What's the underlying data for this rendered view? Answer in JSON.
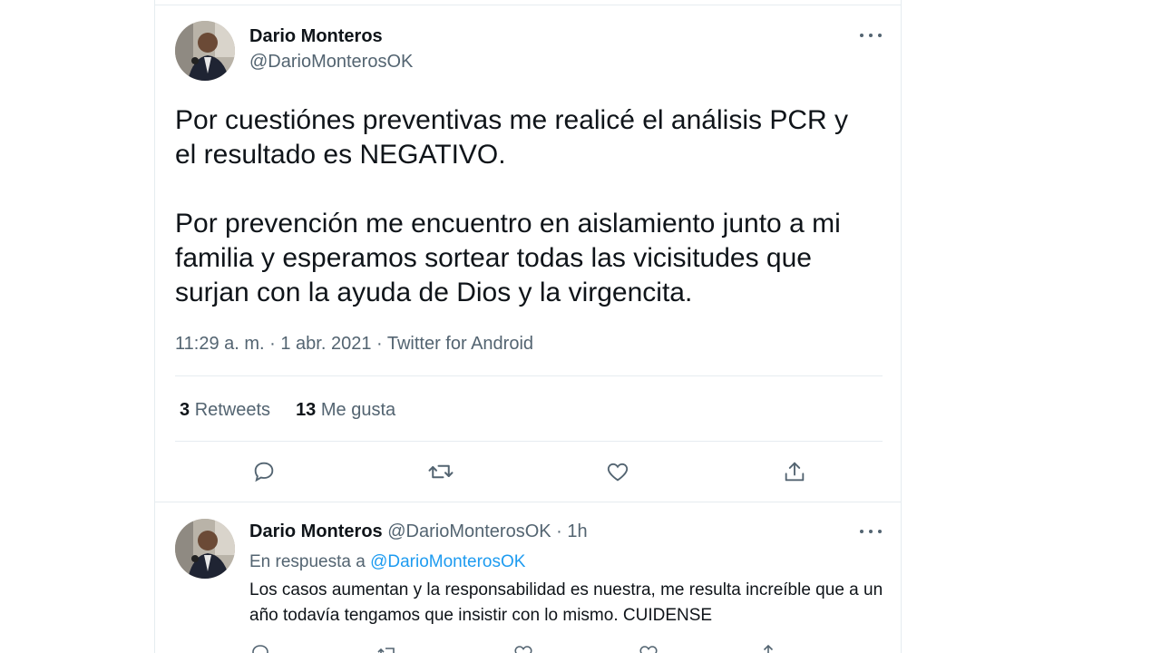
{
  "main_tweet": {
    "author_name": "Dario Monteros",
    "author_handle": "@DarioMonterosOK",
    "text": "Por cuestiónes preventivas me realicé el análisis PCR y\nel resultado es NEGATIVO.\n\nPor prevención me encuentro en aislamiento junto a mi\nfamilia y esperamos sortear todas las vicisitudes que\nsurjan con la ayuda de Dios y la virgencita.",
    "timestamp": "11:29 a. m. · 1 abr. 2021 · Twitter for Android",
    "retweets_count": "3",
    "retweets_label": "Retweets",
    "likes_count": "13",
    "likes_label": "Me gusta",
    "icons": [
      "more-icon",
      "reply-icon",
      "retweet-icon",
      "like-icon",
      "share-icon"
    ]
  },
  "reply_tweet": {
    "author_name": "Dario Monteros",
    "author_handle_time": "@DarioMonterosOK · 1h",
    "in_reply_prefix": "En respuesta a",
    "in_reply_handle": "@DarioMonterosOK",
    "text": "Los casos aumentan y la responsabilidad es nuestra, me resulta increíble que a un año todavía tengamos que insistir con lo mismo. CUIDENSE"
  },
  "colors": {
    "text_primary": "#0f1419",
    "text_secondary": "#536471",
    "link": "#1d9bf0",
    "border": "#e6ecf0"
  }
}
